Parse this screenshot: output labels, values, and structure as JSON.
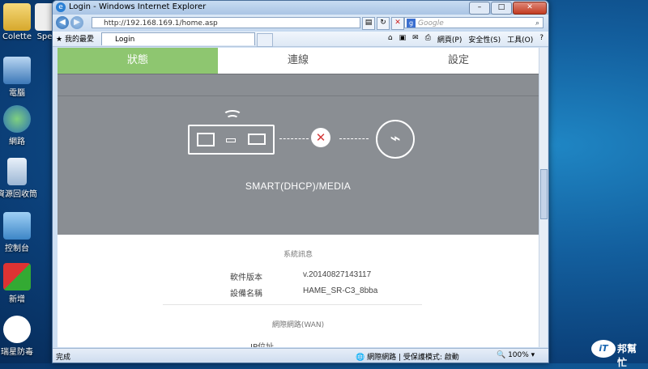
{
  "desktop_icons": [
    {
      "label": "Colette",
      "icon": "folder-icon"
    },
    {
      "label": "Spe",
      "icon": "document-icon"
    },
    {
      "label": "電腦",
      "icon": "computer-icon"
    },
    {
      "label": "網路",
      "icon": "network-icon"
    },
    {
      "label": "資源回收筒",
      "icon": "recycle-bin-icon"
    },
    {
      "label": "控制台",
      "icon": "control-panel-icon"
    },
    {
      "label": "新增",
      "icon": "app-icon"
    },
    {
      "label": "瑞星防毒",
      "icon": "antivirus-icon"
    }
  ],
  "browser": {
    "title": "Login - Windows Internet Explorer",
    "url": "http://192.168.169.1/home.asp",
    "search_placeholder": "Google",
    "favorites_label": "我的最愛",
    "tab_label": "Login",
    "command_labels": [
      "網頁(P)",
      "安全性(S)",
      "工具(O)"
    ],
    "status_left": "完成",
    "status_zone": "網際網路 | 受保護模式: 啟動",
    "zoom": "100%"
  },
  "page": {
    "nav_tabs": [
      "狀態",
      "連線",
      "設定"
    ],
    "active_tab": "狀態",
    "connection_mode": "SMART(DHCP)/MEDIA",
    "system_section": "系統訊息",
    "fields": [
      {
        "label": "軟件版本",
        "value": "v.20140827143117"
      },
      {
        "label": "設備名稱",
        "value": "HAME_SR-C3_8bba"
      }
    ],
    "wan_section": "網際網路(WAN)",
    "ip_label": "IP位址"
  },
  "logo": {
    "bubble": "iT",
    "text": "邦幫忙"
  },
  "colors": {
    "active_tab": "#8ec670",
    "status_panel": "#8a8e93",
    "error": "#d43a3a"
  }
}
